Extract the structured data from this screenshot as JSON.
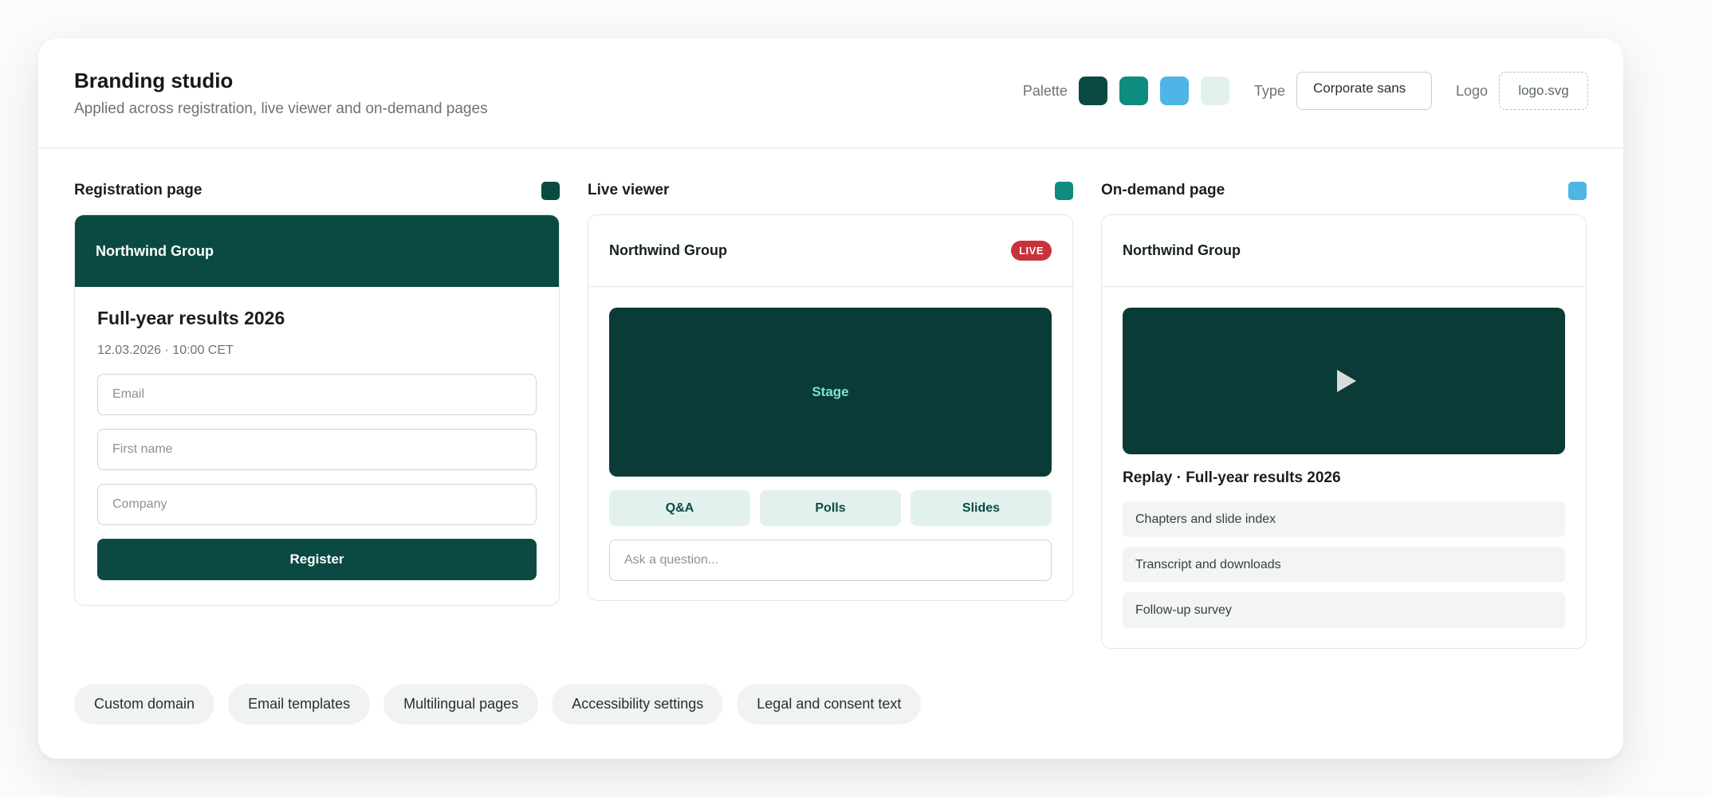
{
  "header": {
    "title": "Branding studio",
    "subtitle": "Applied across registration, live viewer and on-demand pages",
    "palette_label": "Palette",
    "palette": [
      "#0b4a42",
      "#0e8c7e",
      "#4fb4e6",
      "#e3f1ee"
    ],
    "type_label": "Type",
    "type_value": "Corporate sans",
    "logo_label": "Logo",
    "logo_value": "logo.svg"
  },
  "registration": {
    "heading": "Registration page",
    "color": "#0b4a42",
    "brand": "Northwind Group",
    "event_title": "Full-year results 2026",
    "event_date": "12.03.2026 · 10:00 CET",
    "fields": [
      {
        "placeholder": "Email"
      },
      {
        "placeholder": "First name"
      },
      {
        "placeholder": "Company"
      }
    ],
    "submit_label": "Register"
  },
  "live": {
    "heading": "Live viewer",
    "color": "#0e8c7e",
    "brand": "Northwind Group",
    "badge": "LIVE",
    "stage_label": "Stage",
    "tabs": [
      "Q&A",
      "Polls",
      "Slides"
    ],
    "ask_placeholder": "Ask a question..."
  },
  "ondemand": {
    "heading": "On-demand page",
    "color": "#4fb4e6",
    "brand": "Northwind Group",
    "play_icon": "play-icon",
    "replay_title": "Replay · Full-year results 2026",
    "items": [
      "Chapters and slide index",
      "Transcript and downloads",
      "Follow-up survey"
    ]
  },
  "chips": [
    "Custom domain",
    "Email templates",
    "Multilingual pages",
    "Accessibility settings",
    "Legal and consent text"
  ]
}
